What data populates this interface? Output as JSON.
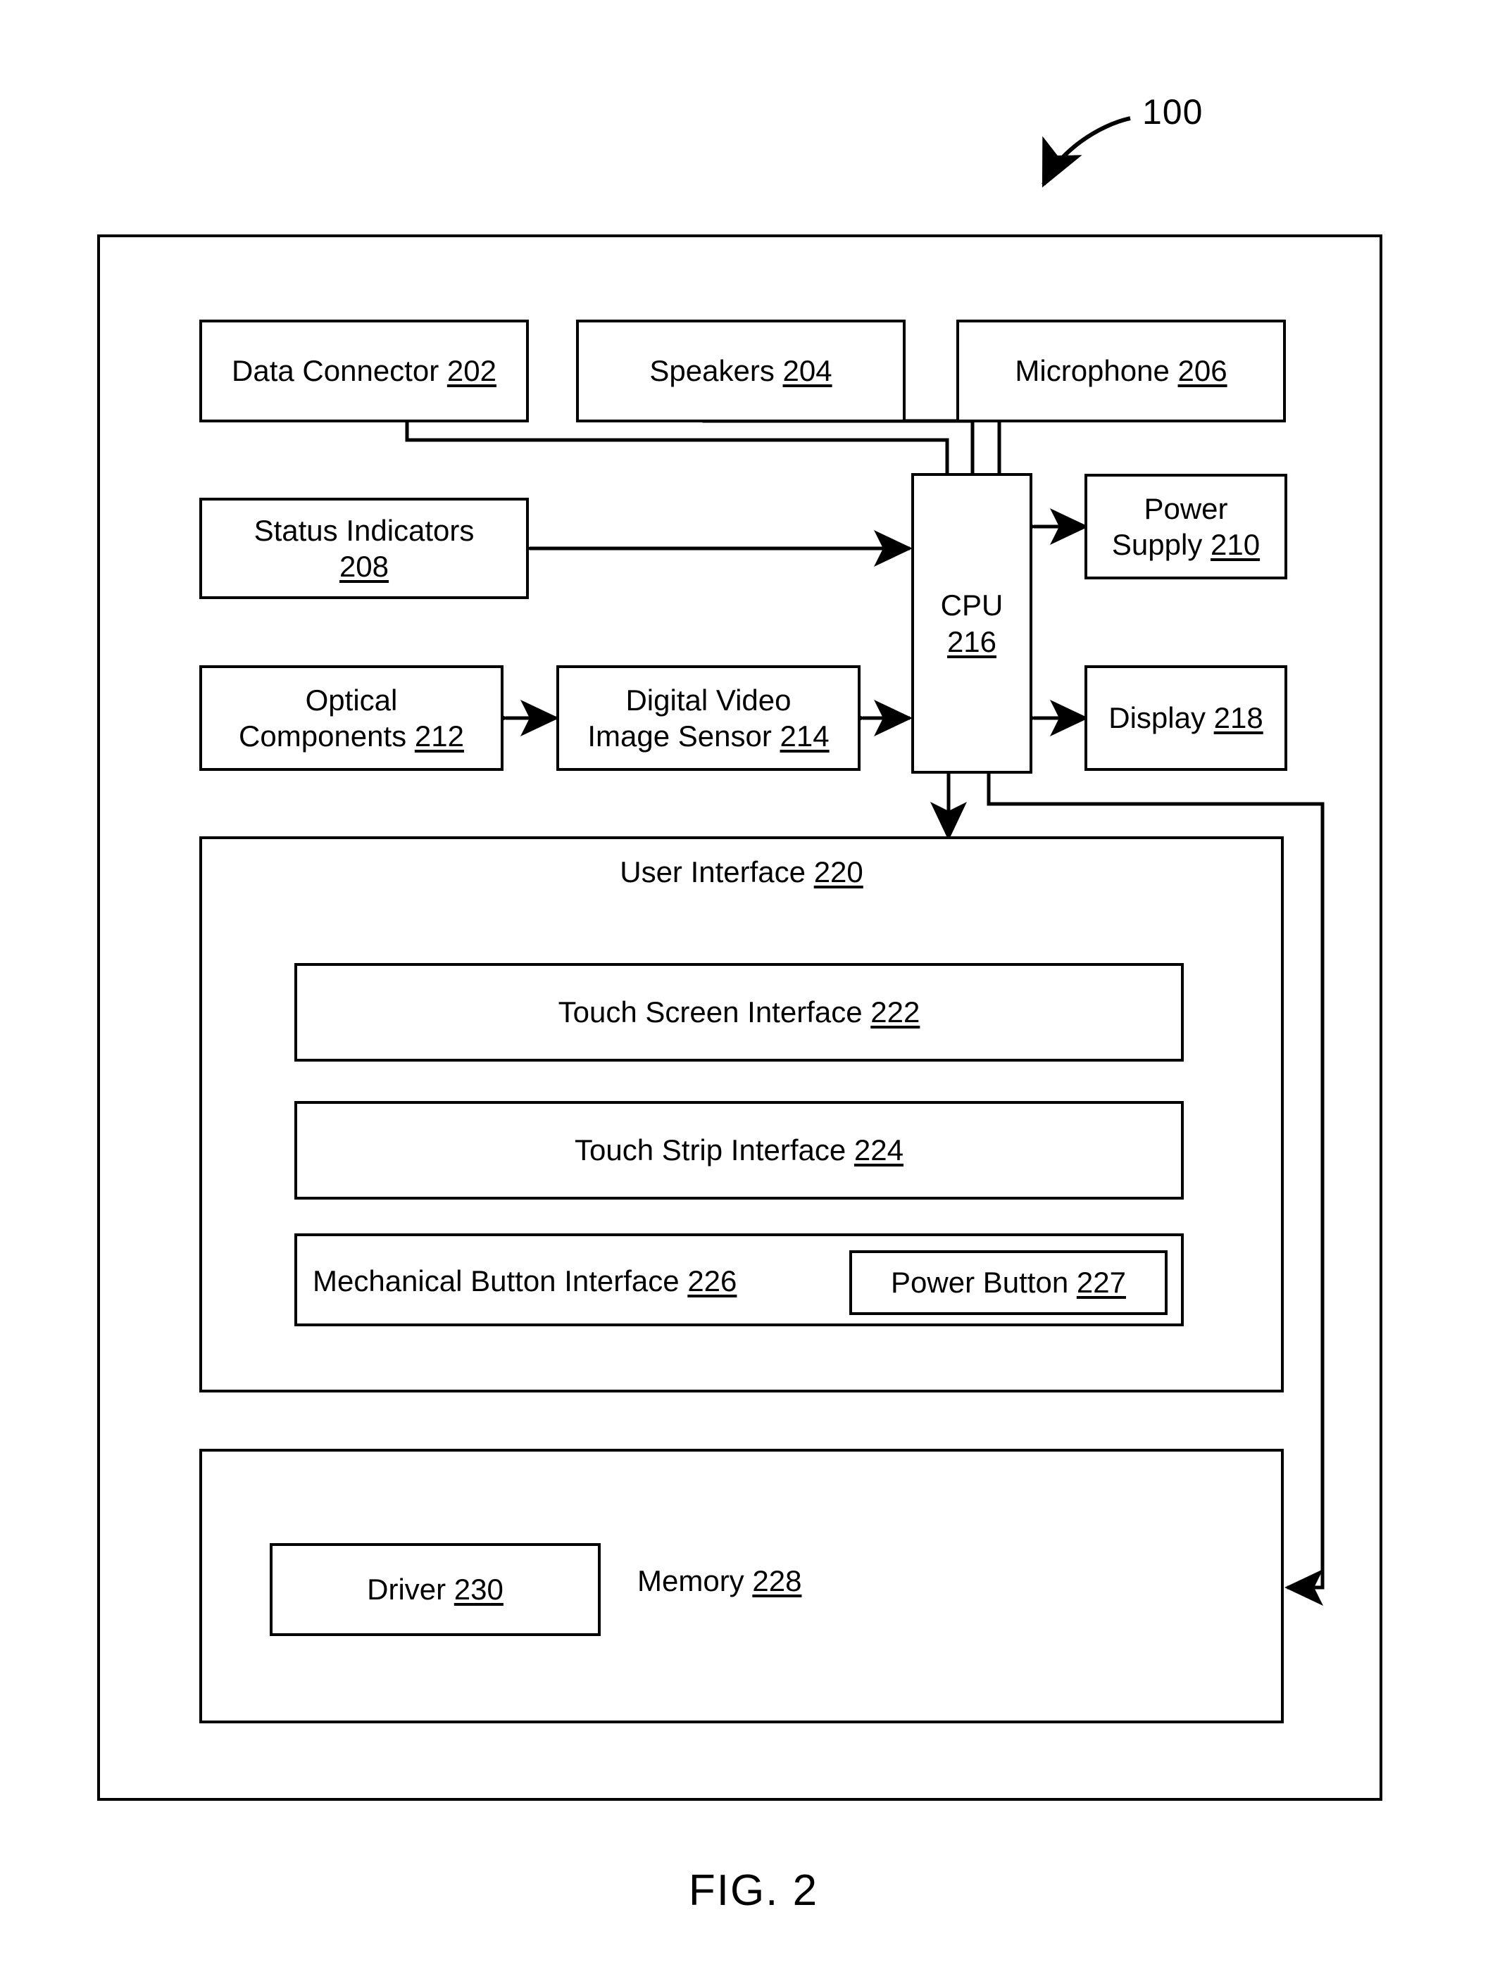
{
  "figure": {
    "caption": "FIG. 2",
    "system_callout": "100"
  },
  "blocks": {
    "data_connector": {
      "label": "Data Connector ",
      "ref": "202"
    },
    "speakers": {
      "label": "Speakers ",
      "ref": "204"
    },
    "microphone": {
      "label": "Microphone ",
      "ref": "206"
    },
    "status_indicators": {
      "label": "Status Indicators",
      "ref": "208"
    },
    "power_supply": {
      "label": "Power\nSupply ",
      "ref": "210"
    },
    "optical_components": {
      "label": "Optical\nComponents ",
      "ref": "212"
    },
    "digital_video_image_sensor": {
      "label": "Digital Video\nImage Sensor ",
      "ref": "214"
    },
    "cpu": {
      "label": "CPU",
      "ref": "216"
    },
    "display": {
      "label": "Display ",
      "ref": "218"
    },
    "user_interface": {
      "label": "User Interface ",
      "ref": "220"
    },
    "touch_screen_interface": {
      "label": "Touch Screen Interface ",
      "ref": "222"
    },
    "touch_strip_interface": {
      "label": "Touch Strip Interface ",
      "ref": "224"
    },
    "mechanical_button_interface": {
      "label": "Mechanical Button Interface ",
      "ref": "226"
    },
    "power_button": {
      "label": "Power Button ",
      "ref": "227"
    },
    "memory": {
      "label": "Memory ",
      "ref": "228"
    },
    "driver": {
      "label": "Driver ",
      "ref": "230"
    }
  },
  "colors": {
    "stroke": "#000000",
    "background": "#ffffff"
  },
  "connections": [
    {
      "from": "speakers",
      "to": "data_connector",
      "type": "unidirectional"
    },
    {
      "from": "microphone",
      "to": "speakers",
      "type": "unidirectional"
    },
    {
      "from": "cpu",
      "to": "data_connector",
      "type": "unidirectional"
    },
    {
      "from": "cpu",
      "to": "speakers",
      "type": "unidirectional"
    },
    {
      "from": "cpu",
      "to": "microphone",
      "type": "bidirectional"
    },
    {
      "from": "cpu",
      "to": "status_indicators",
      "type": "bidirectional"
    },
    {
      "from": "cpu",
      "to": "power_supply",
      "type": "bidirectional"
    },
    {
      "from": "cpu",
      "to": "display",
      "type": "bidirectional"
    },
    {
      "from": "cpu",
      "to": "digital_video_image_sensor",
      "type": "bidirectional"
    },
    {
      "from": "digital_video_image_sensor",
      "to": "optical_components",
      "type": "bidirectional"
    },
    {
      "from": "cpu",
      "to": "user_interface",
      "type": "bidirectional"
    },
    {
      "from": "cpu",
      "to": "memory",
      "type": "unidirectional"
    }
  ]
}
